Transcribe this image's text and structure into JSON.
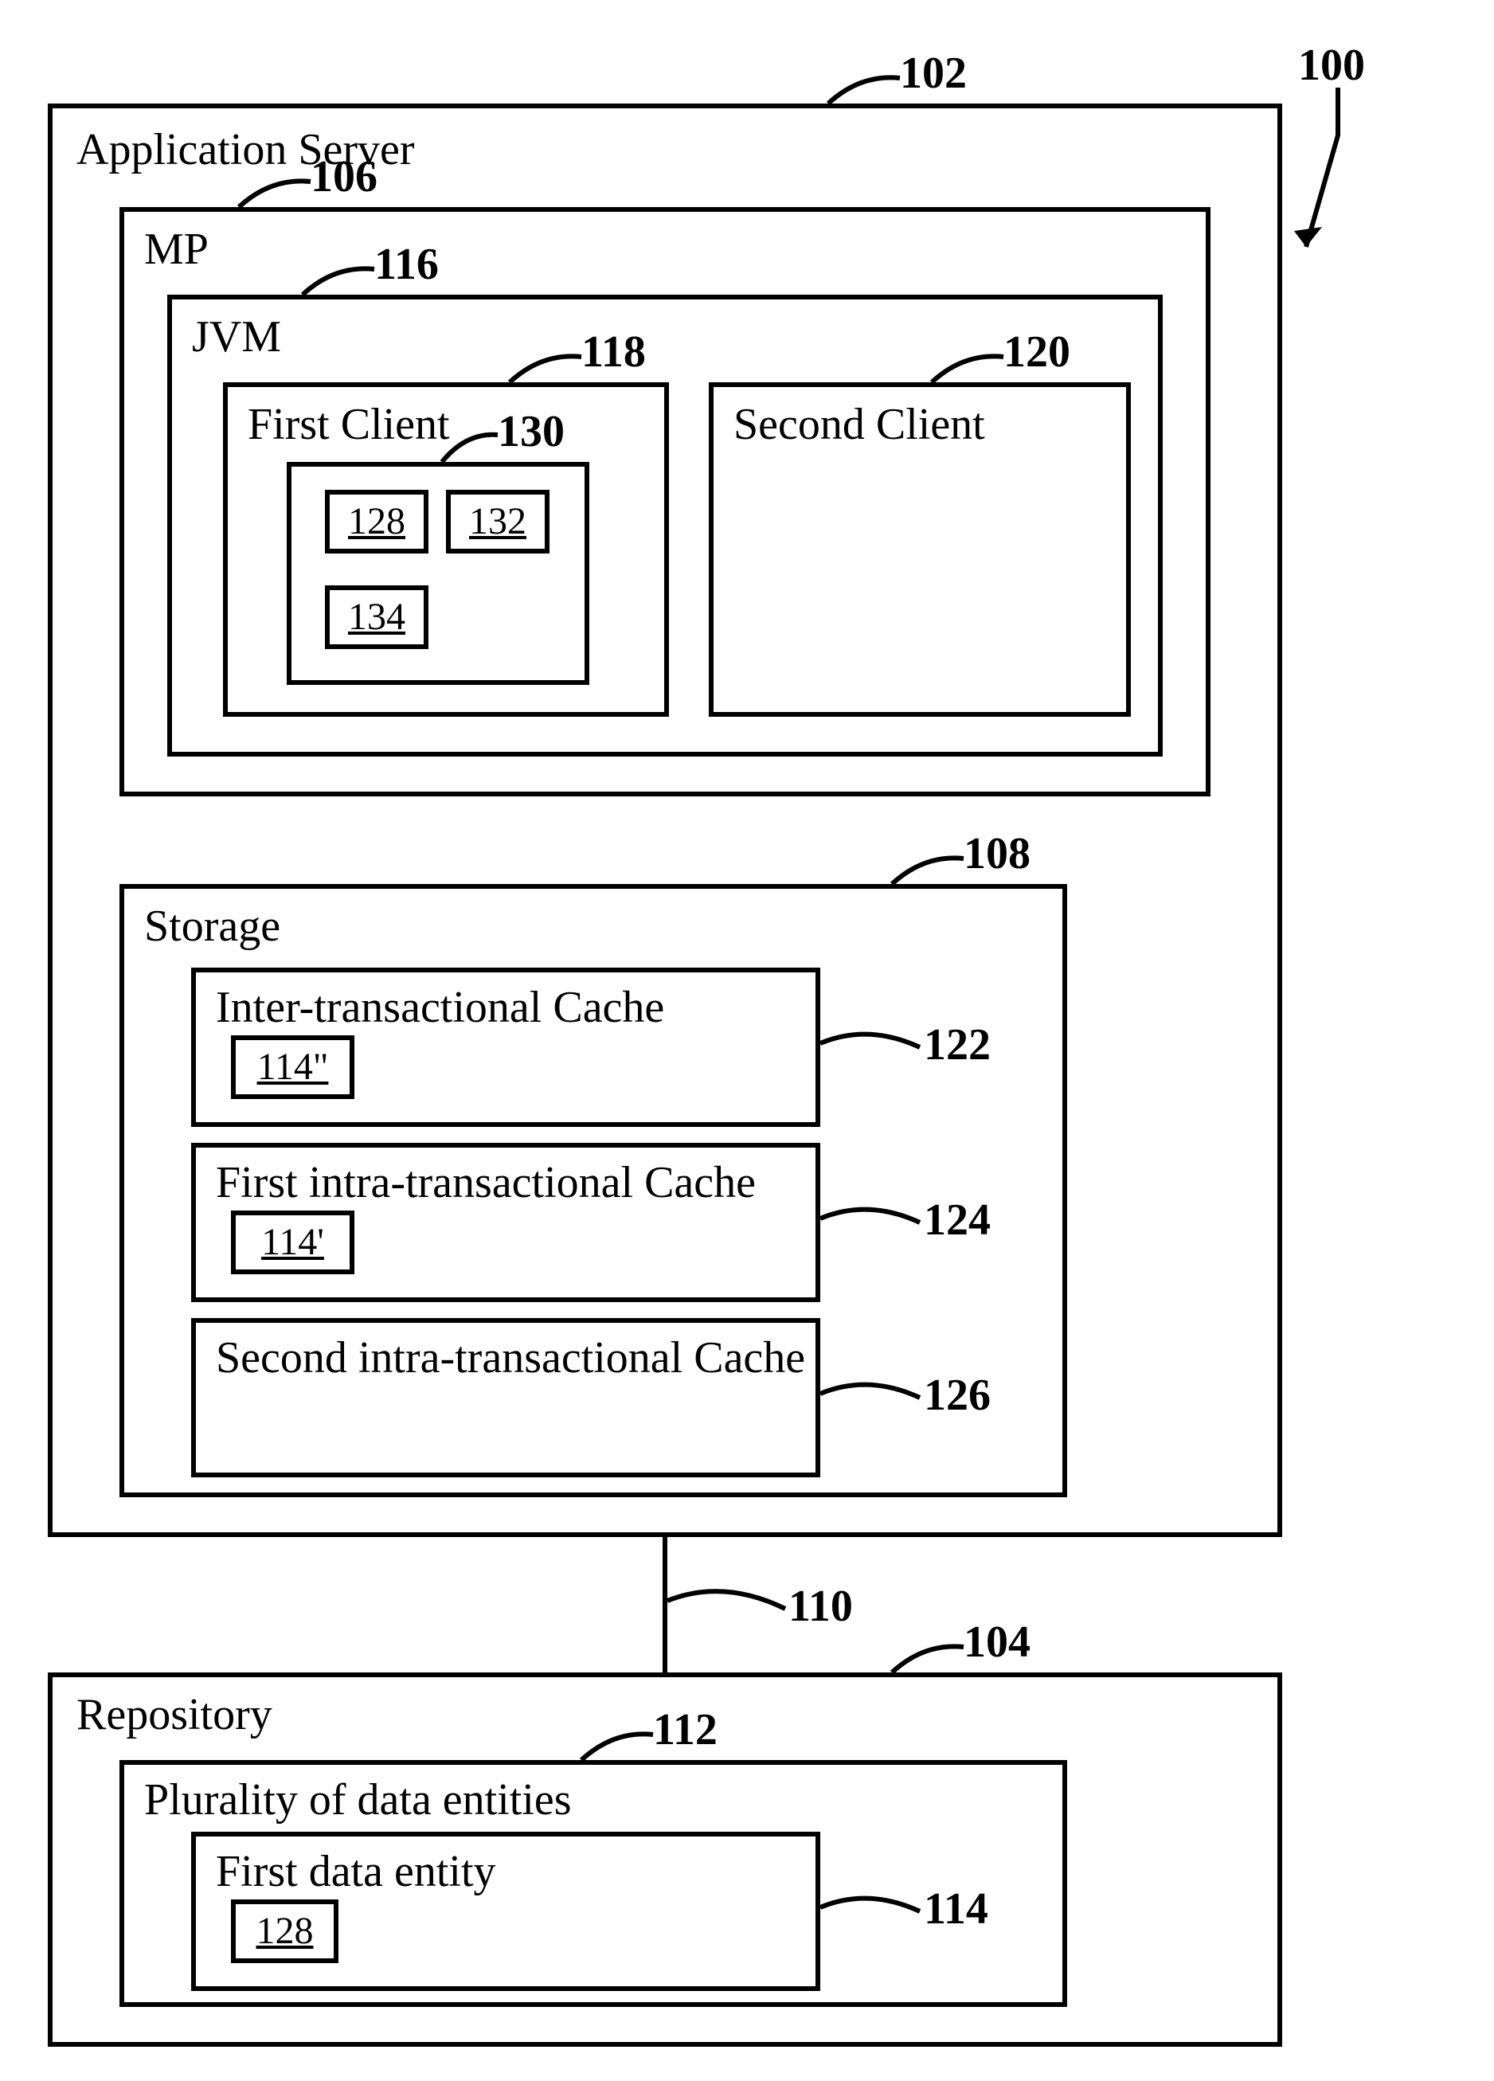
{
  "labels": {
    "l100": "100",
    "l102": "102",
    "l104": "104",
    "l106": "106",
    "l108": "108",
    "l110": "110",
    "l112": "112",
    "l114": "114",
    "l116": "116",
    "l118": "118",
    "l120": "120",
    "l122": "122",
    "l124": "124",
    "l126": "126",
    "l130": "130"
  },
  "titles": {
    "appServer": "Application Server",
    "mp": "MP",
    "jvm": "JVM",
    "firstClient": "First Client",
    "secondClient": "Second Client",
    "storage": "Storage",
    "interCache": "Inter-transactional Cache",
    "firstIntraCache": "First intra-transactional Cache",
    "secondIntraCache": "Second intra-transactional Cache",
    "repository": "Repository",
    "plurality": "Plurality of data entities",
    "firstDataEntity": "First data entity"
  },
  "chips": {
    "c128a": "128",
    "c132": "132",
    "c134": "134",
    "c114dd": "114\"",
    "c114d": "114'",
    "c128b": "128"
  }
}
